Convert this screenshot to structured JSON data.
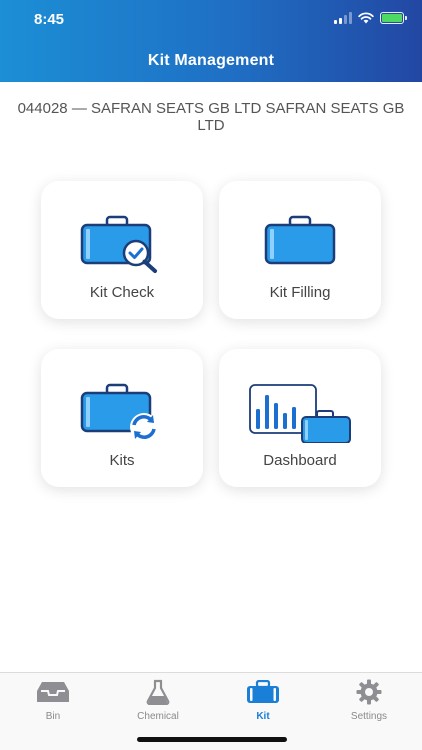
{
  "status_bar": {
    "time": "8:45"
  },
  "header": {
    "title": "Kit Management"
  },
  "company": {
    "text": "044028 — SAFRAN SEATS GB LTD SAFRAN SEATS GB LTD"
  },
  "cards": [
    {
      "label": "Kit Check",
      "icon": "suitcase-check-icon"
    },
    {
      "label": "Kit Filling",
      "icon": "suitcase-icon"
    },
    {
      "label": "Kits",
      "icon": "suitcase-refresh-icon"
    },
    {
      "label": "Dashboard",
      "icon": "dashboard-chart-icon"
    }
  ],
  "tabs": [
    {
      "label": "Bin",
      "icon": "bin-tray-icon",
      "active": false
    },
    {
      "label": "Chemical",
      "icon": "flask-icon",
      "active": false
    },
    {
      "label": "Kit",
      "icon": "suitcase-icon",
      "active": true
    },
    {
      "label": "Settings",
      "icon": "gear-icon",
      "active": false
    }
  ],
  "colors": {
    "header_start": "#1c8fd6",
    "header_end": "#2247a3",
    "accent": "#1a7fd6",
    "suitcase_blue": "#2a9be8"
  }
}
